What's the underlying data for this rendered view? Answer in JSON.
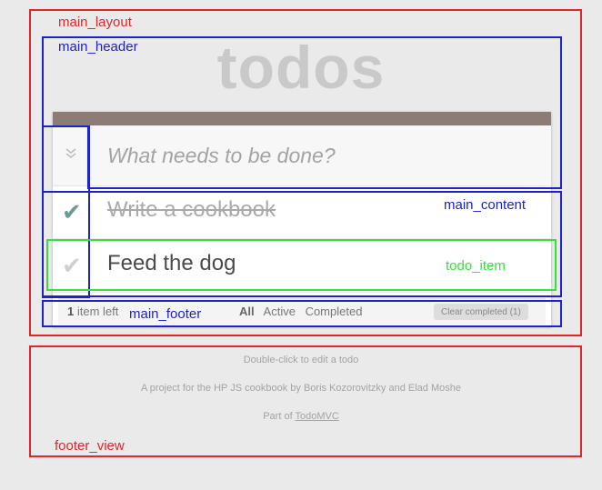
{
  "header": {
    "title": "todos"
  },
  "new_todo": {
    "placeholder": "What needs to be done?",
    "toggle_all_icon": "chevron-double-down-icon"
  },
  "todos": [
    {
      "label": "Write a cookbook",
      "completed": true
    },
    {
      "label": "Feed the dog",
      "completed": false
    }
  ],
  "footer": {
    "count_number": "1",
    "count_suffix": " item left",
    "filters": [
      "All",
      "Active",
      "Completed"
    ],
    "selected_filter": "All",
    "clear_label": "Clear completed (1)"
  },
  "info": {
    "line1": "Double-click to edit a todo",
    "line2": "A project for the HP JS cookbook by Boris Kozorovitzky and Elad Moshe",
    "line3_prefix": "Part of ",
    "line3_link": "TodoMVC"
  },
  "annotations": {
    "main_layout": "main_layout",
    "main_header": "main_header",
    "main_content": "main_content",
    "todo_item": "todo_item",
    "main_footer": "main_footer",
    "footer_view": "footer_view"
  },
  "colors": {
    "topbar": "#8d7c75",
    "overlay_red": "#e0262a",
    "overlay_blue": "#1d22c9",
    "overlay_green": "#34e03a"
  }
}
